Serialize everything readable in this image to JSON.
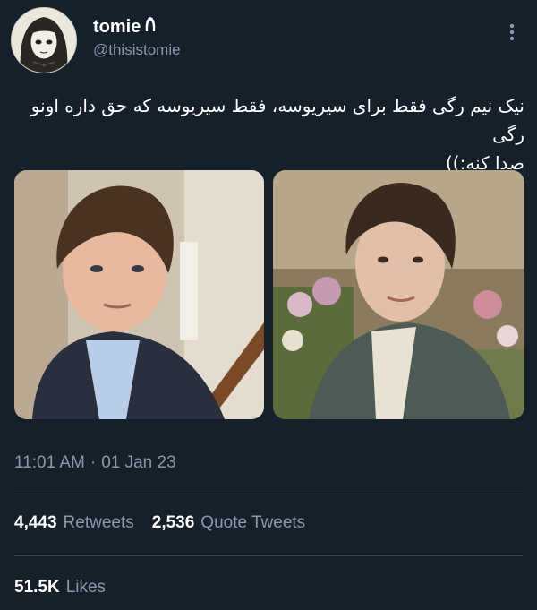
{
  "author": {
    "display_name": "tomie",
    "handle": "@thisistomie",
    "avatar_icon": "manga-girl-avatar",
    "name_emoji_icon": "hair-emoji-icon"
  },
  "tweet": {
    "text_line1": "نیک نیم رگی فقط برای سیریوسه، فقط سیریوسه که حق داره اونو رگی",
    "text_line2": "صدا کنه:))"
  },
  "media": [
    {
      "description": "young boy in denim jacket on staircase",
      "name": "photo-left"
    },
    {
      "description": "young man in tweed jacket in front of flowers",
      "name": "photo-right"
    }
  ],
  "meta": {
    "time": "11:01 AM",
    "separator": "·",
    "date": "01 Jan 23"
  },
  "stats": {
    "retweets_count": "4,443",
    "retweets_label": "Retweets",
    "quotes_count": "2,536",
    "quotes_label": "Quote Tweets",
    "likes_count": "51.5K",
    "likes_label": "Likes"
  },
  "colors": {
    "background": "#15202b",
    "secondary_text": "#8b98a5",
    "divider": "#38444d"
  }
}
